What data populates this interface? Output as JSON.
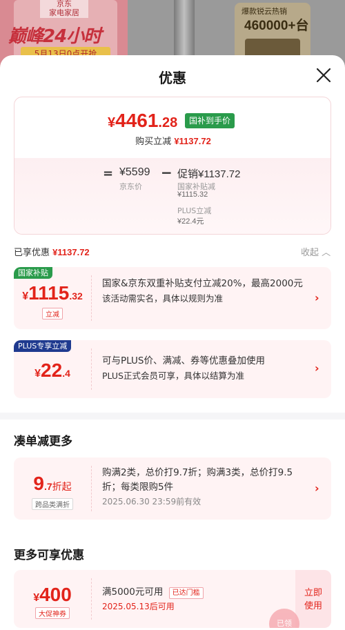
{
  "background": {
    "store_logo": "京东\n家电家居",
    "banner_headline": "巅峰24小时",
    "banner_date": "5月13日0点开抢",
    "right_badge_title": "爆款锐云热销",
    "right_badge_count": "460000+台"
  },
  "sheet": {
    "title": "优惠"
  },
  "summary": {
    "final_price_currency": "¥",
    "final_price_int": "4461",
    "final_price_dec": ".28",
    "subsidy_tag": "国补到手价",
    "reduce_label": "购买立减",
    "reduce_amount": "¥1137.72",
    "equals": "=",
    "jd_price": "¥5599",
    "jd_price_label": "京东价",
    "minus": "−",
    "promo_label": "促销",
    "promo_amount": "¥1137.72",
    "detail1_label": "国家补贴减",
    "detail1_amount": "¥1115.32",
    "detail2_label": "PLUS立减",
    "detail2_amount": "¥22.4元"
  },
  "enjoyed": {
    "label": "已享优惠",
    "amount": "¥1137.72",
    "collapse_label": "收起 ︿"
  },
  "coupons": [
    {
      "tag": "国家补贴",
      "tag_color": "#2a9b4b",
      "currency": "¥",
      "int": "1115",
      "dec": ".32",
      "sub": "立减",
      "desc": "国家&京东双重补贴支付立减20%，最高2000元",
      "desc2": "该活动需实名，具体以规则为准"
    },
    {
      "tag": "PLUS专享立减",
      "tag_color": "#1f3a8f",
      "currency": "¥",
      "int": "22",
      "dec": ".4",
      "desc": "可与PLUS价、满减、券等优惠叠加使用",
      "desc2": "PLUS正式会员可享，具体以结算为准"
    }
  ],
  "bundle": {
    "title": "凑单减更多",
    "int": "9",
    "dec": ".7",
    "unit": "折起",
    "sub": "跨品类满折",
    "desc": "购满2类，总价打9.7折；购满3类，总价打9.5折；每类限购5件",
    "expiry": "2025.06.30  23:59前有效"
  },
  "more": {
    "title": "更多可享优惠",
    "currency": "¥",
    "int": "400",
    "sub": "大促神券",
    "desc": "满5000元可用",
    "threshold_tag": "已达门槛",
    "date": "2025.05.13后可用",
    "use_button": "立即\n使用",
    "stamp": "已领"
  },
  "colors": {
    "price_red": "#e2231a",
    "card_pink": "#fff3f4",
    "subsidy_green": "#2a9b4b",
    "plus_blue": "#1f3a8f"
  },
  "icons": {
    "close": "close-icon",
    "chevron": "chevron-right-icon"
  }
}
